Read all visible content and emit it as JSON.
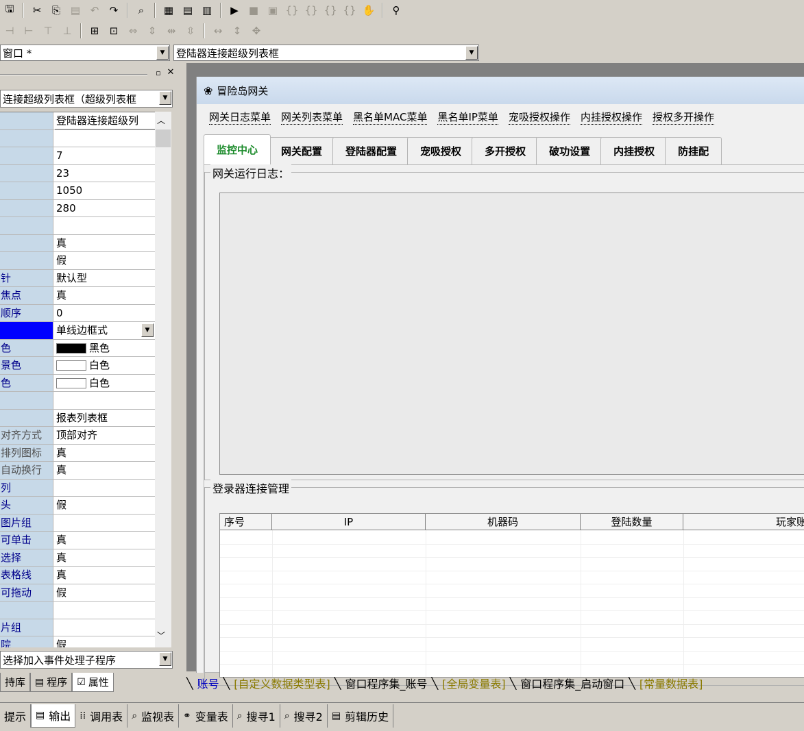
{
  "toolbar1": {
    "icons": [
      "save-icon",
      "cut-icon",
      "copy-icon",
      "paste-icon",
      "undo-icon",
      "redo-icon",
      "find-icon",
      "layout1-icon",
      "layout2-icon",
      "layout3-icon",
      "run-icon",
      "stop-icon",
      "compile-icon",
      "step-into-icon",
      "step-over-icon",
      "step-out-icon",
      "run-to-cursor-icon",
      "hand-icon",
      "binoculars-icon"
    ]
  },
  "toolbar2": {
    "icons": [
      "align-left-icon",
      "align-right-icon",
      "align-top-icon",
      "align-bottom-icon",
      "center-h-icon",
      "center-v-icon",
      "same-width-icon",
      "same-height-icon",
      "space-h-icon",
      "space-v-icon",
      "width-icon",
      "height-icon",
      "size-icon"
    ]
  },
  "combos": {
    "window": "窗口 *",
    "component": "登陆器连接超级列表框"
  },
  "leftpanel": {
    "object_combo": "连接超级列表框（超级列表框",
    "event_combo": "选择加入事件处理子程序",
    "properties": [
      {
        "name": "",
        "value": "登陆器连接超级列"
      },
      {
        "name": "",
        "value": ""
      },
      {
        "name": "",
        "value": "7"
      },
      {
        "name": "",
        "value": "23"
      },
      {
        "name": "",
        "value": "1050"
      },
      {
        "name": "",
        "value": "280"
      },
      {
        "name": "",
        "value": ""
      },
      {
        "name": "",
        "value": "真"
      },
      {
        "name": "",
        "value": "假"
      },
      {
        "name": "针",
        "value": "默认型"
      },
      {
        "name": "焦点",
        "value": "真"
      },
      {
        "name": "顺序",
        "value": "0"
      },
      {
        "name": "",
        "value": "单线边框式"
      },
      {
        "name": "色",
        "value": "黑色"
      },
      {
        "name": "景色",
        "value": "白色"
      },
      {
        "name": "色",
        "value": "白色"
      },
      {
        "name": "",
        "value": ""
      },
      {
        "name": "",
        "value": "报表列表框"
      },
      {
        "name": "对齐方式",
        "value": "顶部对齐"
      },
      {
        "name": "排列图标",
        "value": "真"
      },
      {
        "name": "自动换行",
        "value": "真"
      },
      {
        "name": "列",
        "value": ""
      },
      {
        "name": "头",
        "value": "假"
      },
      {
        "name": "图片组",
        "value": ""
      },
      {
        "name": "可单击",
        "value": "真"
      },
      {
        "name": "选择",
        "value": "真"
      },
      {
        "name": "表格线",
        "value": "真"
      },
      {
        "name": "可拖动",
        "value": "假"
      },
      {
        "name": "",
        "value": ""
      },
      {
        "name": "片组",
        "value": ""
      },
      {
        "name": "院",
        "value": "假"
      }
    ],
    "tabs": [
      "持库",
      "程序",
      "属性"
    ]
  },
  "form": {
    "title": "冒险岛网关",
    "menus": [
      "网关日志菜单",
      "网关列表菜单",
      "黑名单MAC菜单",
      "黑名单IP菜单",
      "宠吸授权操作",
      "内挂授权操作",
      "授权多开操作"
    ],
    "tabs": [
      "监控中心",
      "网关配置",
      "登陆器配置",
      "宠吸授权",
      "多开授权",
      "破功设置",
      "内挂授权",
      "防挂配"
    ],
    "log_group": "网关运行日志：",
    "conn_group": "登录器连接管理",
    "columns": [
      "序号",
      "IP",
      "机器码",
      "登陆数量",
      "玩家账号"
    ]
  },
  "editor_tabs": [
    "账号",
    "[自定义数据类型表]",
    "窗口程序集_账号",
    "[全局变量表]",
    "窗口程序集_启动窗口",
    "[常量数据表]"
  ],
  "output_tabs": [
    "提示",
    "输出",
    "调用表",
    "监视表",
    "变量表",
    "搜寻1",
    "搜寻2",
    "剪辑历史"
  ],
  "colors": {
    "accent_tab": "#1a8a2a",
    "prop_name_bg": "#c7d9e8",
    "yellow_tab": "#8a7a00"
  }
}
